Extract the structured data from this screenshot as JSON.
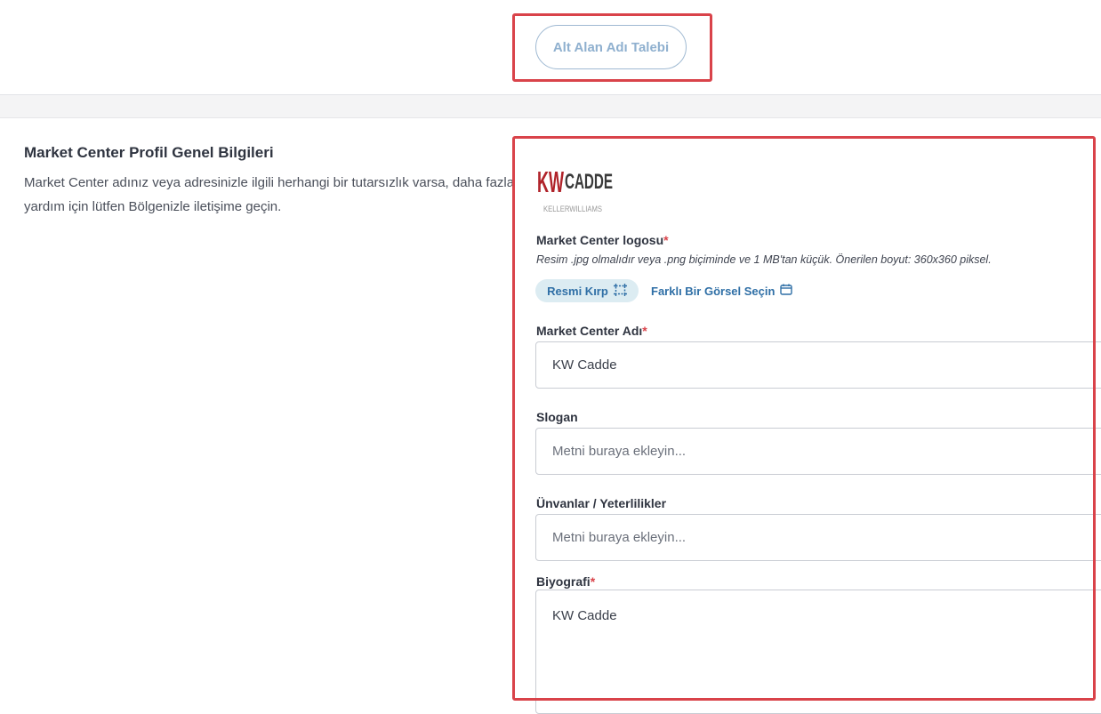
{
  "header": {
    "subdomain_button_label": "Alt Alan Adı Talebi"
  },
  "section": {
    "title": "Market Center Profil Genel Bilgileri",
    "description": "Market Center adınız veya adresinizle ilgili herhangi bir tutarsızlık varsa, daha fazla yardım için lütfen Bölgenizle iletişime geçin."
  },
  "logo": {
    "text_main": "KW CADDE",
    "text_sub": "KELLERWILLIAMS",
    "brand_color": "#b0232a"
  },
  "logo_field": {
    "label": "Market Center logosu",
    "required_mark": "*",
    "hint": "Resim .jpg olmalıdır veya .png biçiminde ve 1 MB'tan küçük. Önerilen boyut: 360x360 piksel.",
    "crop_label": "Resmi Kırp",
    "crop_icon": "crop-icon",
    "choose_label": "Farklı Bir Görsel Seçin",
    "choose_icon": "calendar-icon"
  },
  "name_field": {
    "label": "Market Center Adı",
    "required_mark": "*",
    "value": "KW Cadde"
  },
  "slogan_field": {
    "label": "Slogan",
    "placeholder": "Metni buraya ekleyin..."
  },
  "titles_field": {
    "label": "Ünvanlar / Yeterlilikler",
    "placeholder": "Metni buraya ekleyin..."
  },
  "bio_field": {
    "label": "Biyografi",
    "required_mark": "*",
    "value": "KW Cadde"
  },
  "colors": {
    "accent": "#2f6fa6",
    "annotation": "#d9434a"
  }
}
